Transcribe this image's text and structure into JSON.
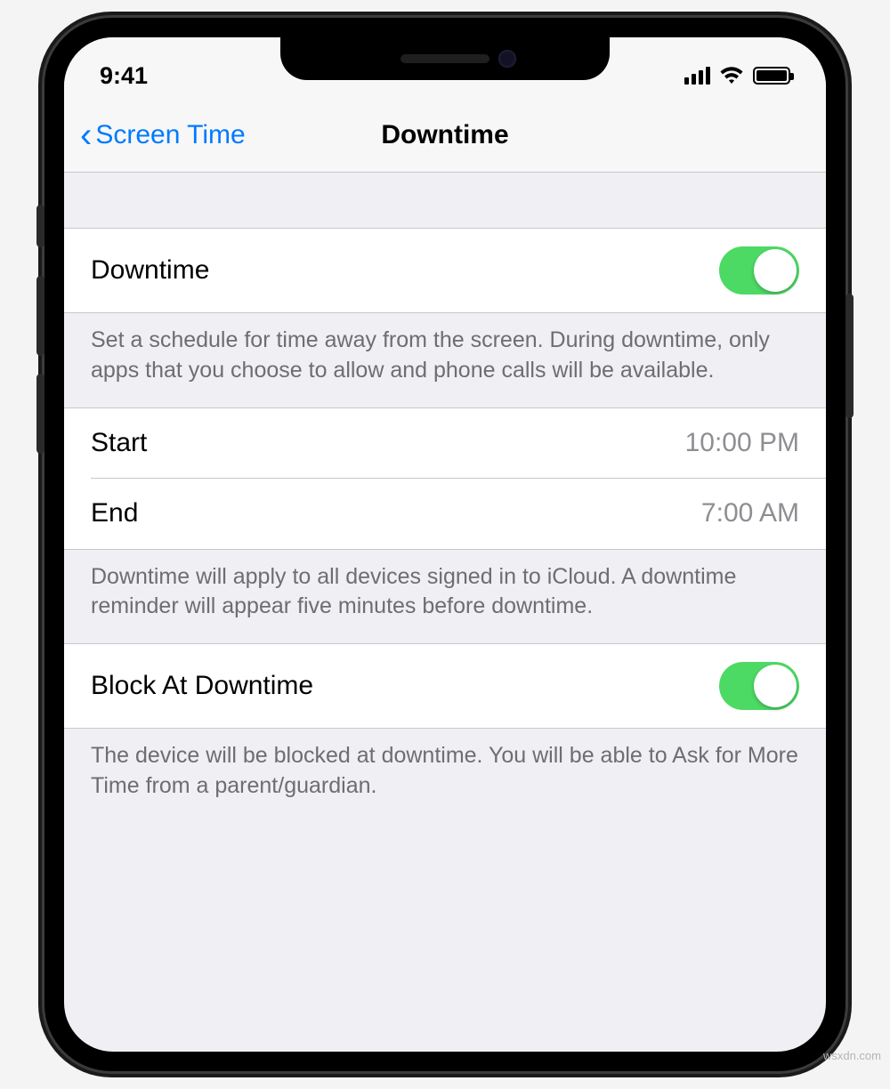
{
  "status": {
    "time": "9:41"
  },
  "nav": {
    "back_label": "Screen Time",
    "title": "Downtime"
  },
  "sections": {
    "downtime_toggle": {
      "label": "Downtime",
      "footer": "Set a schedule for time away from the screen. During downtime, only apps that you choose to allow and phone calls will be available."
    },
    "schedule": {
      "start_label": "Start",
      "start_value": "10:00 PM",
      "end_label": "End",
      "end_value": "7:00 AM",
      "footer": "Downtime will apply to all devices signed in to iCloud. A downtime reminder will appear five minutes before downtime."
    },
    "block": {
      "label": "Block At Downtime",
      "footer": "The device will be blocked at downtime. You will be able to Ask for More Time from a parent/guardian."
    }
  },
  "watermark": "wsxdn.com"
}
